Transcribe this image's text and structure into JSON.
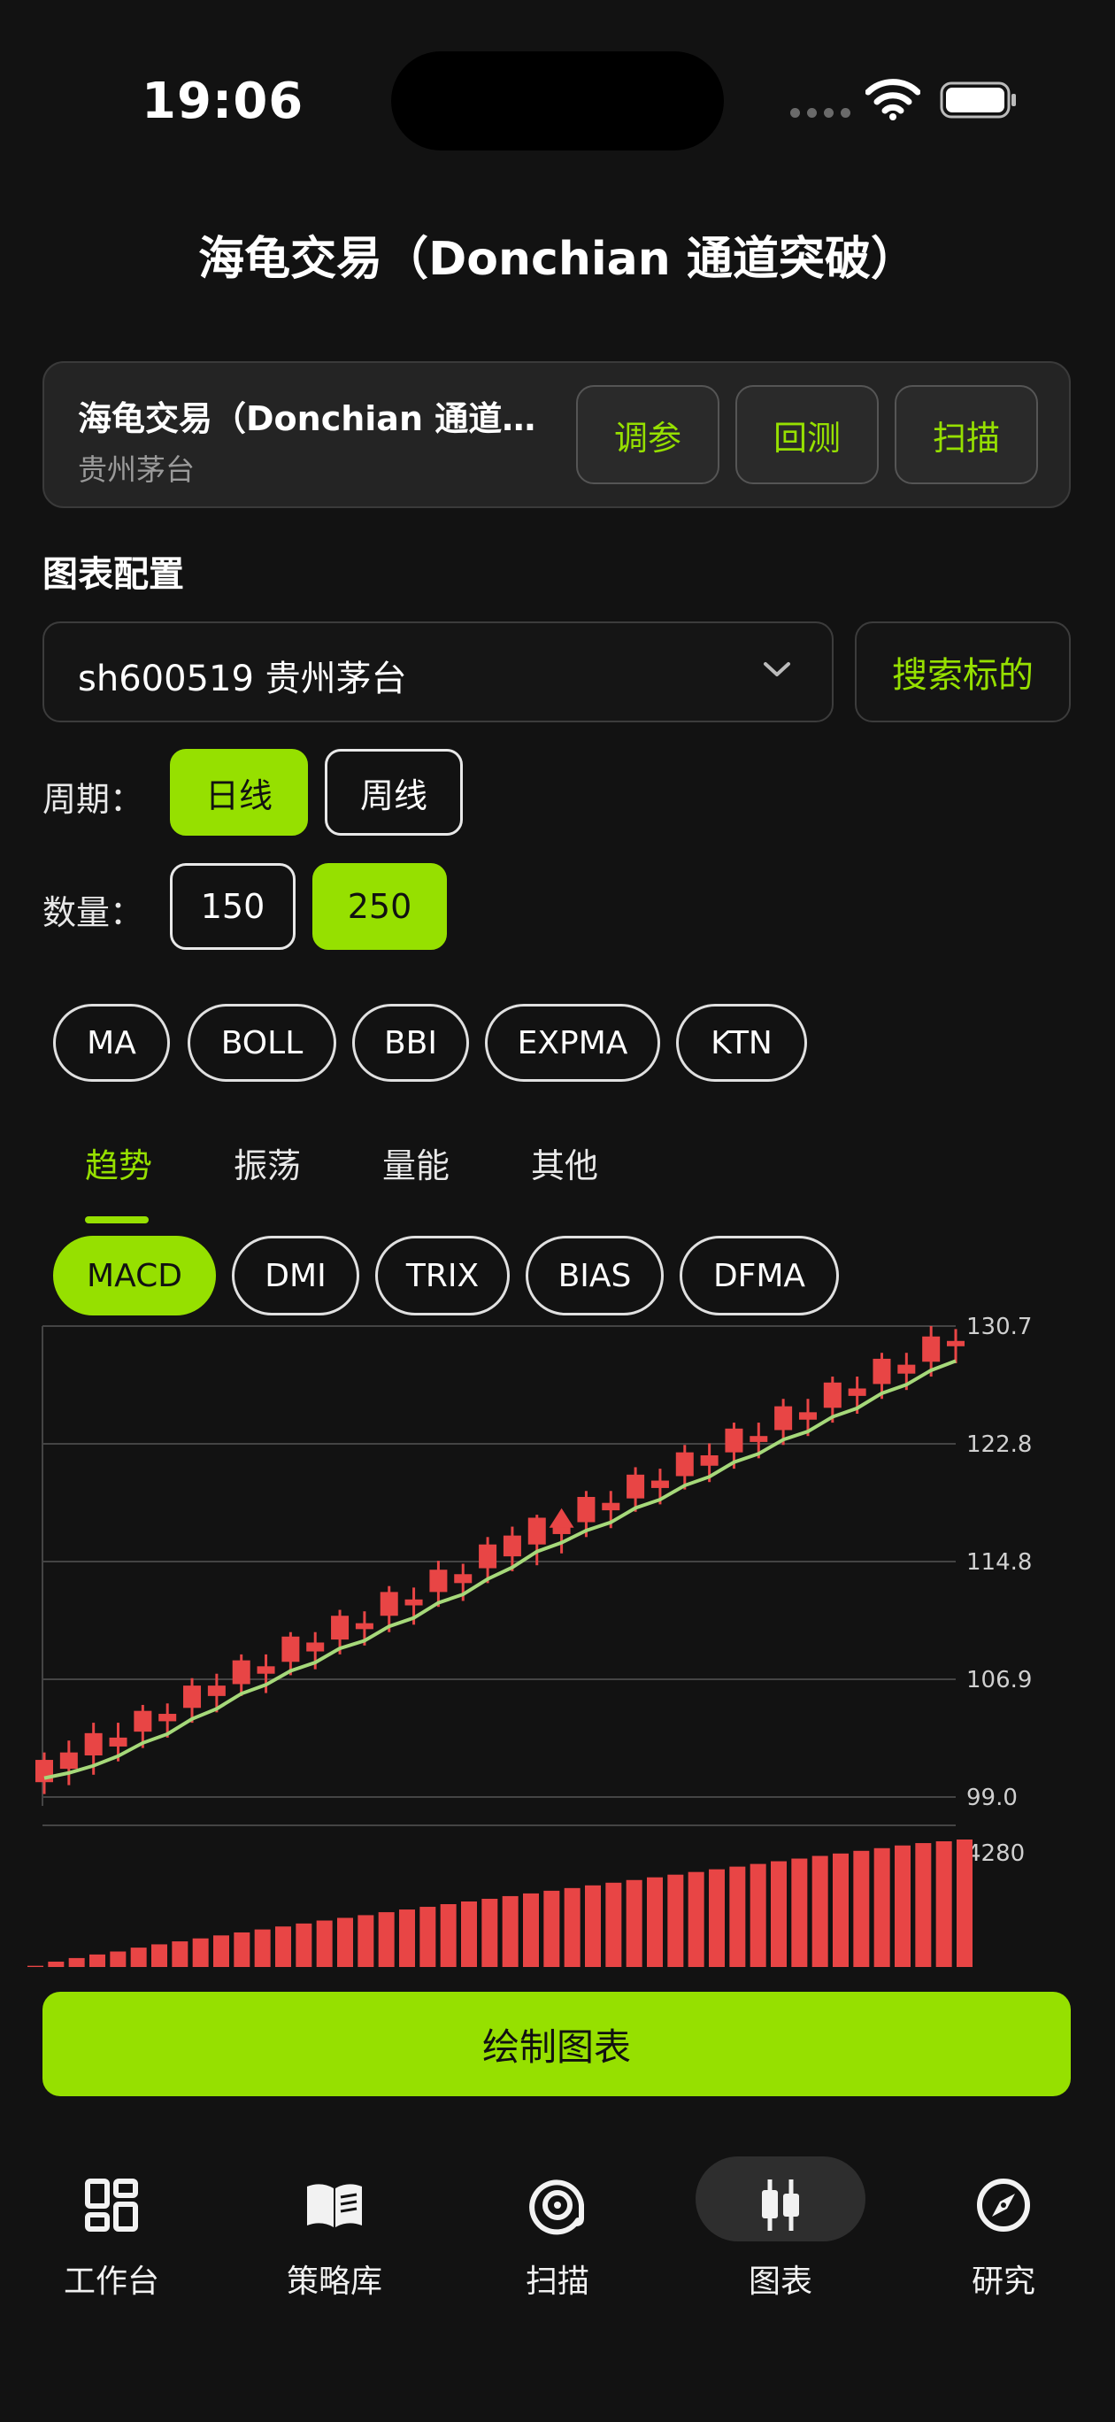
{
  "status": {
    "time": "19:06"
  },
  "page": {
    "title": "海龟交易（Donchian 通道突破）"
  },
  "strategy_card": {
    "name": "海龟交易（Donchian 通道突破）",
    "stock": "贵州茅台",
    "buttons": [
      "调参",
      "回测",
      "扫描"
    ]
  },
  "config": {
    "section_title": "图表配置",
    "symbol": "sh600519 贵州茅台",
    "search_label": "搜索标的",
    "period_label": "周期：",
    "periods": [
      "日线",
      "周线"
    ],
    "period_active": "日线",
    "count_label": "数量：",
    "counts": [
      "150",
      "250"
    ],
    "count_active": "250"
  },
  "overlays": [
    "MA",
    "BOLL",
    "BBI",
    "EXPMA",
    "KTN"
  ],
  "indicator_tabs": [
    "趋势",
    "振荡",
    "量能",
    "其他"
  ],
  "indicator_tab_active": "趋势",
  "indicators": [
    "MACD",
    "DMI",
    "TRIX",
    "BIAS",
    "DFMA"
  ],
  "indicator_active": "MACD",
  "chart_data": {
    "type": "candlestick",
    "y_ticks": [
      "130.7",
      "122.8",
      "114.8",
      "106.9",
      "99.0"
    ],
    "ylim": [
      99.0,
      130.7
    ],
    "volume_label": "4280",
    "volume_max": 4280,
    "colors": {
      "candle": "#e84545",
      "ma_line": "#a6d97a",
      "grid": "#444444",
      "tick_text": "#d0d0d0"
    },
    "candles": [
      [
        100,
        102.0,
        99.2,
        101.5
      ],
      [
        100.9,
        102.8,
        99.8,
        102.0
      ],
      [
        101.8,
        104.0,
        100.5,
        103.3
      ],
      [
        102.4,
        104.0,
        101.4,
        103.0
      ],
      [
        103.4,
        105.2,
        102.3,
        104.8
      ],
      [
        104.1,
        105.3,
        103.0,
        104.6
      ],
      [
        105.0,
        107.0,
        104.0,
        106.5
      ],
      [
        105.8,
        107.3,
        104.7,
        106.5
      ],
      [
        106.6,
        108.6,
        105.8,
        108.2
      ],
      [
        107.3,
        108.6,
        106.0,
        107.8
      ],
      [
        108.1,
        110.1,
        107.2,
        109.8
      ],
      [
        108.8,
        110.1,
        107.6,
        109.4
      ],
      [
        109.6,
        111.6,
        108.6,
        111.2
      ],
      [
        110.3,
        111.5,
        109.2,
        110.7
      ],
      [
        111.2,
        113.2,
        110.1,
        112.8
      ],
      [
        111.9,
        113.1,
        110.6,
        112.3
      ],
      [
        112.8,
        114.9,
        111.8,
        114.3
      ],
      [
        113.4,
        114.7,
        112.2,
        114.0
      ],
      [
        114.4,
        116.5,
        113.4,
        116.0
      ],
      [
        115.2,
        117.2,
        114.2,
        116.6
      ],
      [
        116.0,
        118.0,
        114.6,
        117.8
      ],
      [
        116.7,
        118.2,
        115.4,
        117.3
      ],
      [
        117.5,
        119.6,
        116.5,
        119.2
      ],
      [
        118.3,
        119.6,
        117.1,
        118.8
      ],
      [
        119.1,
        121.2,
        118.2,
        120.7
      ],
      [
        119.8,
        121.1,
        118.7,
        120.3
      ],
      [
        120.6,
        122.7,
        119.7,
        122.2
      ],
      [
        121.3,
        122.8,
        120.2,
        122.0
      ],
      [
        122.2,
        124.2,
        121.1,
        123.8
      ],
      [
        122.9,
        124.2,
        121.8,
        123.3
      ],
      [
        123.7,
        125.8,
        122.7,
        125.3
      ],
      [
        124.4,
        125.8,
        123.3,
        124.9
      ],
      [
        125.2,
        127.3,
        124.2,
        126.9
      ],
      [
        126.0,
        127.3,
        124.8,
        126.5
      ],
      [
        126.8,
        128.9,
        125.8,
        128.5
      ],
      [
        127.5,
        128.9,
        126.4,
        128.1
      ],
      [
        128.3,
        130.7,
        127.3,
        130.0
      ],
      [
        129.4,
        130.5,
        128.2,
        129.7
      ]
    ],
    "signal_index": 21,
    "volumes": [
      40,
      180,
      300,
      420,
      520,
      650,
      760,
      860,
      960,
      1060,
      1160,
      1260,
      1360,
      1460,
      1560,
      1650,
      1740,
      1840,
      1930,
      2020,
      2110,
      2200,
      2290,
      2380,
      2470,
      2560,
      2650,
      2740,
      2830,
      2920,
      3010,
      3100,
      3190,
      3280,
      3370,
      3460,
      3550,
      3640,
      3730,
      3810,
      3900,
      3990,
      4080,
      4160,
      4220,
      4280
    ]
  },
  "draw_button": "绘制图表",
  "nav": {
    "items": [
      "工作台",
      "策略库",
      "扫描",
      "图表",
      "研究"
    ],
    "active": "图表"
  }
}
